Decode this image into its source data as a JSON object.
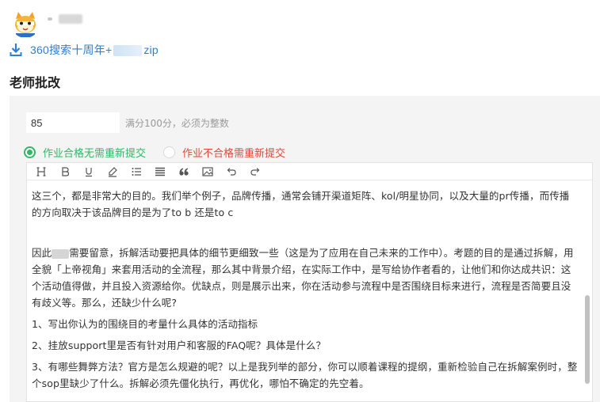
{
  "user": {
    "avatar_icon": "cartoon-cat-avatar"
  },
  "attachment": {
    "icon": "download-icon",
    "name_prefix": "360搜索十周年+",
    "name_suffix": "zip",
    "color": "#2d7fd3"
  },
  "section_title": "老师批改",
  "score": {
    "value": "85",
    "hint": "满分100分，必须为整数"
  },
  "grading": {
    "pass_label": "作业合格无需重新提交",
    "fail_label": "作业不合格需重新提交",
    "selected": "pass",
    "pass_color": "#2fb865",
    "fail_color": "#e04a3a"
  },
  "toolbar": {
    "buttons": [
      "heading-icon",
      "bold-icon",
      "underline-icon",
      "highlight-icon",
      "bullet-list-icon",
      "align-icon",
      "quote-icon",
      "image-icon",
      "undo-icon",
      "redo-icon"
    ]
  },
  "editor": {
    "p1": "这三个，都是非常大的目的。我们举个例子，品牌传播，通常会铺开渠道矩阵、kol/明星协同，以及大量的pr传播，而传播的方向取决于该品牌目的是为了to b 还是to c",
    "p2_prefix": "因此",
    "p2_rest": "需要留意，拆解活动要把具体的细节更细致一些（这是为了应用在自己未来的工作中）。考题的目的是通过拆解，用全貌「上帝视角」来套用活动的全流程，那么其中背景介绍，在实际工作中，是写给协作者看的，让他们和你达成共识：这个活动值得做，并且投入资源给你。优缺点，则是展示出来，你在活动参与流程中是否围绕目标来进行，流程是否简要且没有歧义等。那么，还缺少什么呢?",
    "p3": "1、写出你认为的围绕目的考量什么具体的活动指标",
    "p4": "2、挂放support里是否有针对用户和客服的FAQ呢？具体是什么？",
    "p5": "3、有哪些舞弊方法？官方是怎么规避的呢？以上是我列举的部分，你可以顺着课程的提纲，重新检验自己在拆解案例时，整个sop里缺少了什么。拆解必须先僵化执行，再优化，哪怕不确定的先空着。"
  }
}
